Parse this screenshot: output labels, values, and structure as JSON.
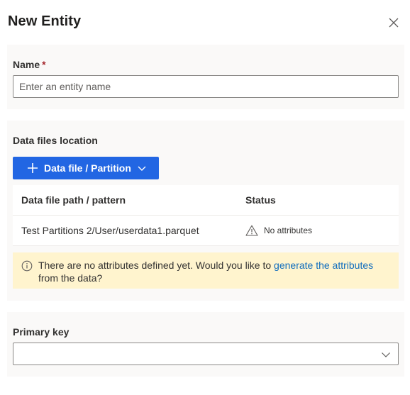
{
  "dialog": {
    "title": "New Entity"
  },
  "name_section": {
    "label": "Name",
    "required_mark": "*",
    "placeholder": "Enter an entity name",
    "value": ""
  },
  "files_section": {
    "label": "Data files location",
    "add_button_label": "Data file / Partition",
    "table": {
      "columns": [
        "Data file path / pattern",
        "Status"
      ],
      "rows": [
        {
          "path": "Test Partitions 2/User/userdata1.parquet",
          "status": "No attributes",
          "status_icon": "warning-icon"
        }
      ]
    },
    "warning": {
      "icon": "info-icon",
      "text_before": "There are no attributes defined yet. Would you like to ",
      "link_text": "generate the attributes",
      "text_after": "from the data?"
    }
  },
  "primary_key_section": {
    "label": "Primary key",
    "selected": ""
  },
  "colors": {
    "primary": "#2266e3",
    "warning_bg": "#fff4ce",
    "link": "#0f6cbd",
    "required": "#a4262c"
  }
}
